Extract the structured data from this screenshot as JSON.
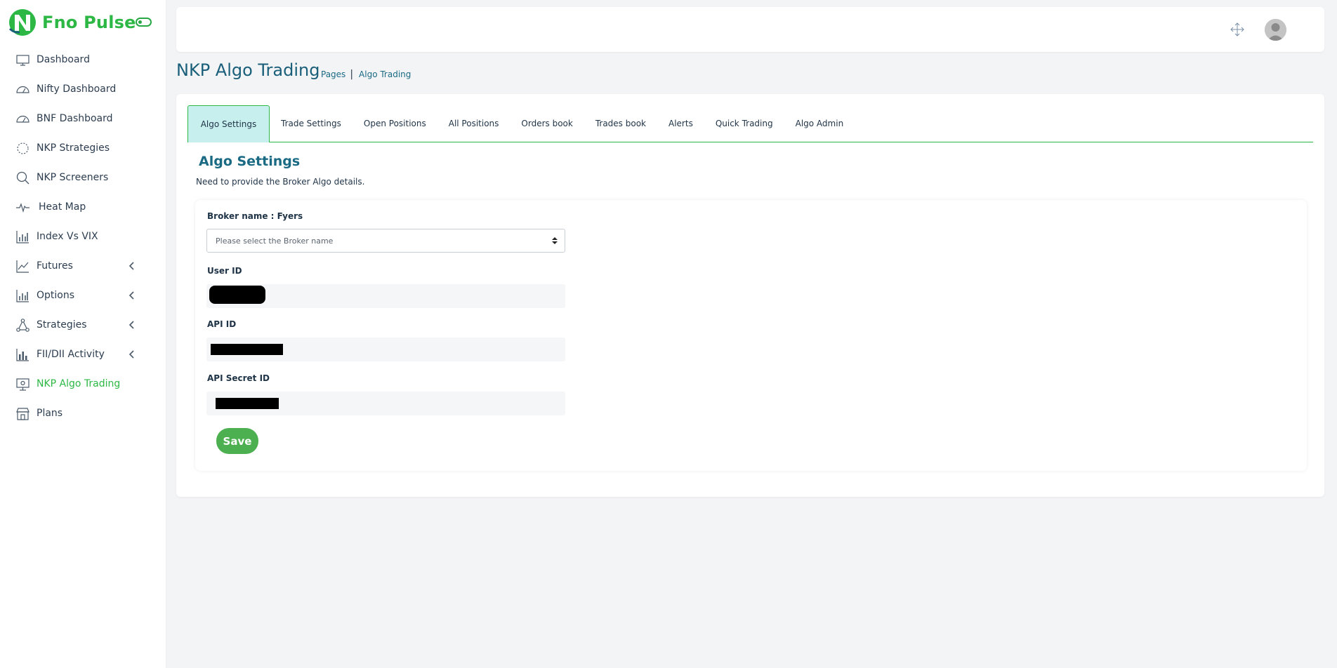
{
  "brand": {
    "name": "Fno Pulse",
    "color": "#2db845"
  },
  "sidebar": {
    "items": [
      {
        "label": "Dashboard",
        "icon": "monitor-icon",
        "has_submenu": false,
        "active": false
      },
      {
        "label": "Nifty Dashboard",
        "icon": "gauge-icon",
        "has_submenu": false,
        "active": false
      },
      {
        "label": "BNF Dashboard",
        "icon": "gauge-icon",
        "has_submenu": false,
        "active": false
      },
      {
        "label": "NKP Strategies",
        "icon": "spinner-icon",
        "has_submenu": false,
        "active": false
      },
      {
        "label": "NKP Screeners",
        "icon": "search-icon",
        "has_submenu": false,
        "active": false
      },
      {
        "label": "Heat Map",
        "icon": "pulse-icon",
        "has_submenu": false,
        "active": false
      },
      {
        "label": "Index Vs VIX",
        "icon": "bar-chart-icon",
        "has_submenu": false,
        "active": false
      },
      {
        "label": "Futures",
        "icon": "line-chart-icon",
        "has_submenu": true,
        "active": false
      },
      {
        "label": "Options",
        "icon": "bar-chart-icon",
        "has_submenu": true,
        "active": false
      },
      {
        "label": "Strategies",
        "icon": "network-icon",
        "has_submenu": true,
        "active": false
      },
      {
        "label": "FII/DII Activity",
        "icon": "column-chart-icon",
        "has_submenu": true,
        "active": false
      },
      {
        "label": "NKP Algo Trading",
        "icon": "presentation-icon",
        "has_submenu": false,
        "active": true
      },
      {
        "label": "Plans",
        "icon": "store-icon",
        "has_submenu": false,
        "active": false
      }
    ]
  },
  "topbar": {
    "fullscreen_icon": "expand-arrows-icon",
    "avatar_icon": "user-avatar-icon"
  },
  "page": {
    "title": "NKP Algo Trading",
    "breadcrumb": {
      "pages": "Pages",
      "separator": "|",
      "current": "Algo Trading"
    }
  },
  "tabs": [
    {
      "label": "Algo Settings",
      "active": true
    },
    {
      "label": "Trade Settings",
      "active": false
    },
    {
      "label": "Open Positions",
      "active": false
    },
    {
      "label": "All Positions",
      "active": false
    },
    {
      "label": "Orders book",
      "active": false
    },
    {
      "label": "Trades book",
      "active": false
    },
    {
      "label": "Alerts",
      "active": false
    },
    {
      "label": "Quick Trading",
      "active": false
    },
    {
      "label": "Algo Admin",
      "active": false
    }
  ],
  "settings": {
    "title": "Algo Settings",
    "subtitle": "Need to provide the Broker Algo details.",
    "broker_label": "Broker name : Fyers",
    "broker_placeholder": "Please select the Broker name",
    "user_id_label": "User ID",
    "api_id_label": "API ID",
    "api_secret_label": "API Secret ID",
    "save_label": "Save"
  },
  "colors": {
    "accent_green": "#2db845",
    "active_tab_bg": "#c7efed",
    "title_blue": "#1a5f7a",
    "save_button": "#4caf50"
  }
}
